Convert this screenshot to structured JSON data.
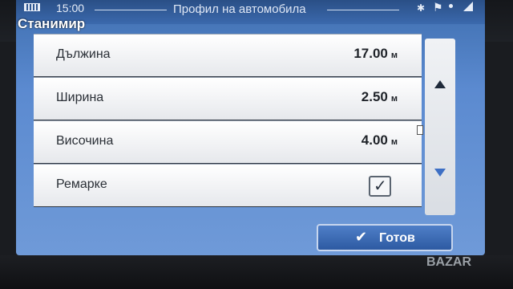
{
  "status_bar": {
    "time": "15:00",
    "title": "Профил на автомобила"
  },
  "user": {
    "name": "Станимир"
  },
  "items": [
    {
      "label": "Дължина",
      "value": "17.00",
      "unit": "м"
    },
    {
      "label": "Ширина",
      "value": "2.50",
      "unit": "м"
    },
    {
      "label": "Височина",
      "value": "4.00",
      "unit": "м"
    },
    {
      "label": "Ремарке",
      "checked": true
    }
  ],
  "buttons": {
    "done_label": "Готов"
  },
  "watermark": "BAZAR",
  "icons": {
    "battery": "battery-icon",
    "bluetooth": "bluetooth-icon",
    "gps": "gps-icon",
    "signal": "signal-icon",
    "scroll_up": "arrow-up-icon",
    "scroll_down": "arrow-down-icon",
    "check": "check-icon"
  },
  "colors": {
    "accent": "#3d6fc4",
    "statusbar": "#2a4f86"
  }
}
